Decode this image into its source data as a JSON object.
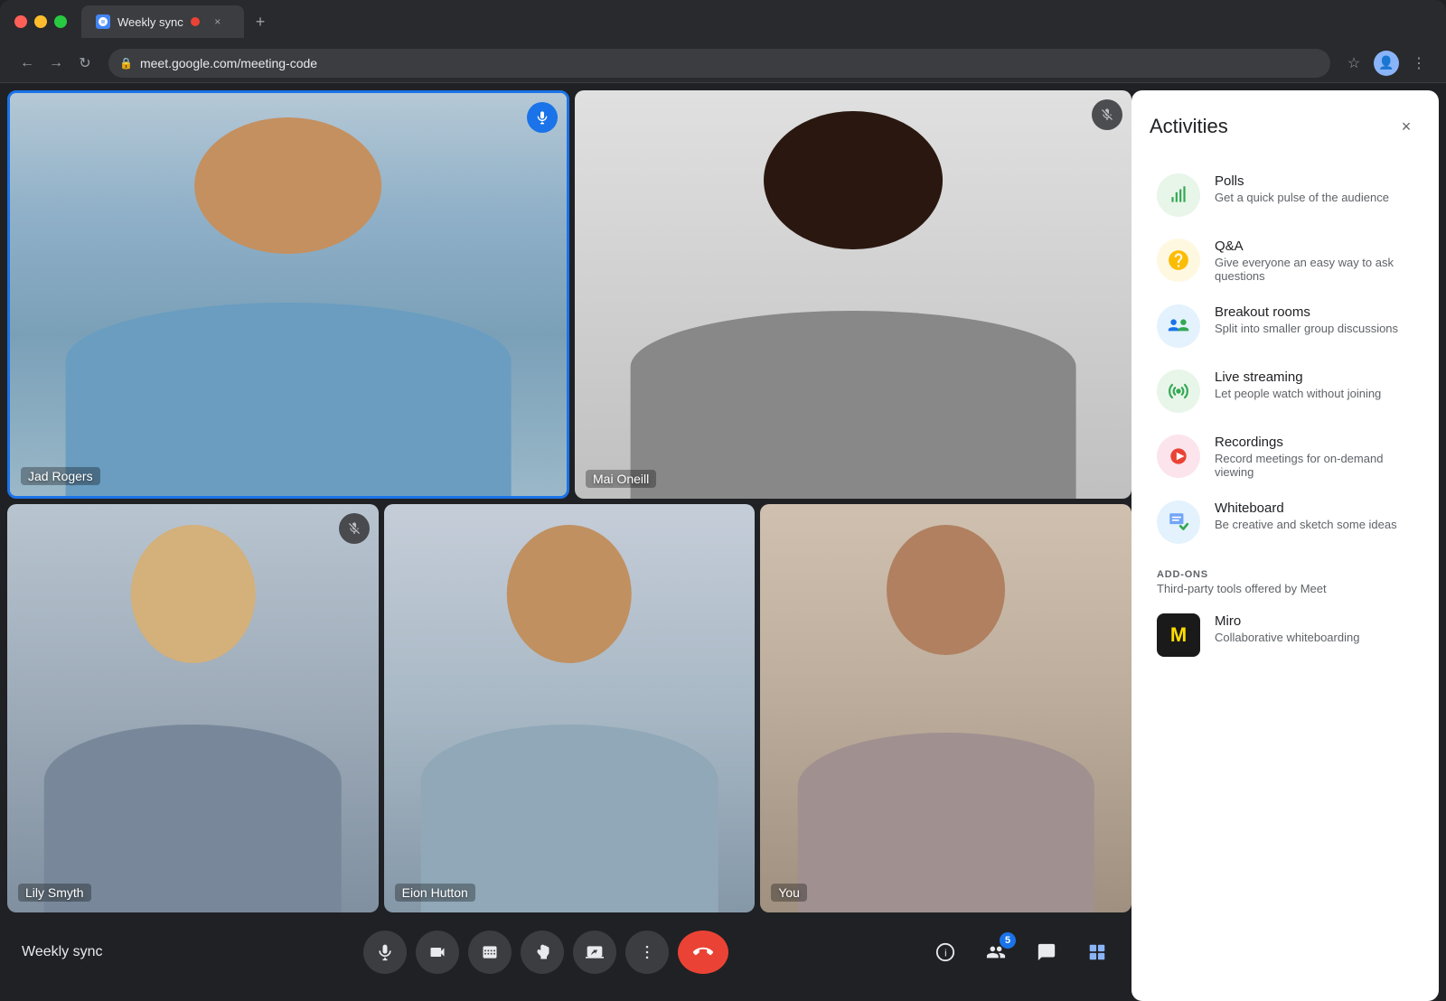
{
  "browser": {
    "tab_title": "Weekly sync",
    "url": "meet.google.com/meeting-code",
    "new_tab_label": "+"
  },
  "participants": [
    {
      "id": "jad",
      "name": "Jad Rogers",
      "muted": false,
      "active_speaker": true,
      "cell_class": "cell-jad"
    },
    {
      "id": "mai",
      "name": "Mai Oneill",
      "muted": true,
      "active_speaker": false,
      "cell_class": "cell-mai"
    },
    {
      "id": "lily",
      "name": "Lily Smyth",
      "muted": true,
      "active_speaker": false,
      "cell_class": "cell-lily"
    },
    {
      "id": "eion",
      "name": "Eion Hutton",
      "muted": false,
      "active_speaker": false,
      "cell_class": "cell-eion"
    },
    {
      "id": "you",
      "name": "You",
      "muted": false,
      "active_speaker": false,
      "cell_class": "cell-you"
    }
  ],
  "controls": {
    "meeting_title": "Weekly sync",
    "mic_label": "🎤",
    "camera_label": "📷",
    "captions_label": "CC",
    "raise_hand_label": "✋",
    "present_label": "⬆",
    "more_label": "⋯",
    "end_call_label": "📞",
    "info_label": "ℹ",
    "people_label": "👥",
    "people_count": "5",
    "chat_label": "💬",
    "activities_label": "⊞"
  },
  "activities_panel": {
    "title": "Activities",
    "close_label": "×",
    "items": [
      {
        "id": "polls",
        "name": "Polls",
        "description": "Get a quick pulse of the audience",
        "icon": "📊",
        "icon_class": "polls"
      },
      {
        "id": "qa",
        "name": "Q&A",
        "description": "Give everyone an easy way to ask questions",
        "icon": "?",
        "icon_class": "qa"
      },
      {
        "id": "breakout",
        "name": "Breakout rooms",
        "description": "Split into smaller group discussions",
        "icon": "👥",
        "icon_class": "breakout"
      },
      {
        "id": "streaming",
        "name": "Live streaming",
        "description": "Let people watch without joining",
        "icon": "📡",
        "icon_class": "streaming"
      },
      {
        "id": "recordings",
        "name": "Recordings",
        "description": "Record meetings for on-demand viewing",
        "icon": "⏺",
        "icon_class": "recordings"
      },
      {
        "id": "whiteboard",
        "name": "Whiteboard",
        "description": "Be creative and sketch some ideas",
        "icon": "✏",
        "icon_class": "whiteboard"
      }
    ],
    "addons": {
      "section_title": "ADD-ONS",
      "section_desc": "Third-party tools offered by Meet",
      "items": [
        {
          "id": "miro",
          "name": "Miro",
          "description": "Collaborative whiteboarding",
          "icon": "M",
          "icon_class": "miro"
        }
      ]
    }
  }
}
